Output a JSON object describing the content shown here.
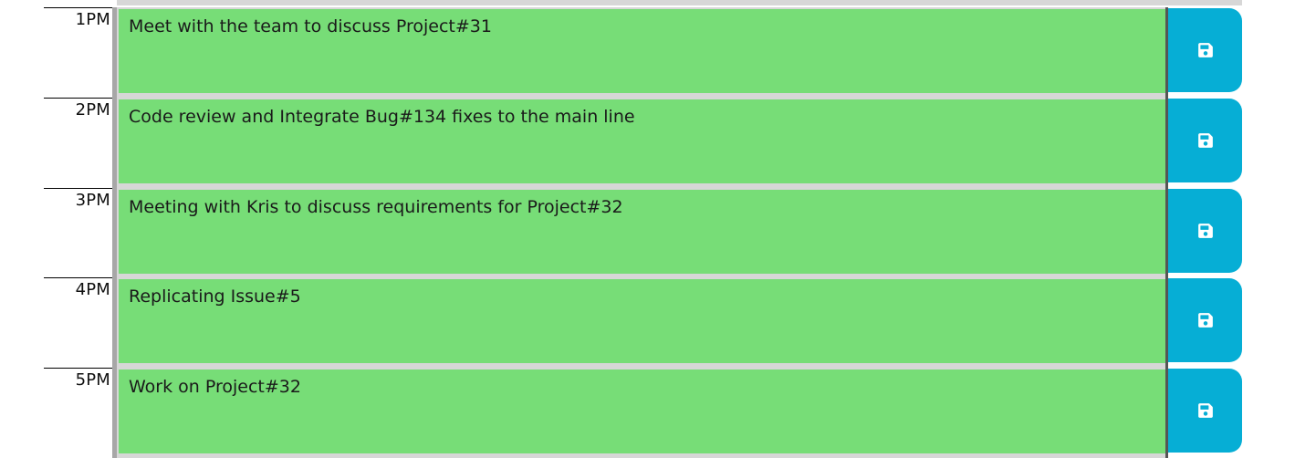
{
  "planner": {
    "rows": [
      {
        "hour": "1PM",
        "text": "Meet with the team to discuss Project#31"
      },
      {
        "hour": "2PM",
        "text": "Code review and Integrate Bug#134 fixes to the main line"
      },
      {
        "hour": "3PM",
        "text": "Meeting with Kris to discuss requirements for Project#32"
      },
      {
        "hour": "4PM",
        "text": "Replicating Issue#5"
      },
      {
        "hour": "5PM",
        "text": "Work on Project#32"
      }
    ]
  },
  "colors": {
    "present_block": "#77dd77",
    "save_button": "#06aed5",
    "hour_gutter": "#a7a7a7"
  },
  "icons": {
    "save": "floppy-disk-icon"
  }
}
